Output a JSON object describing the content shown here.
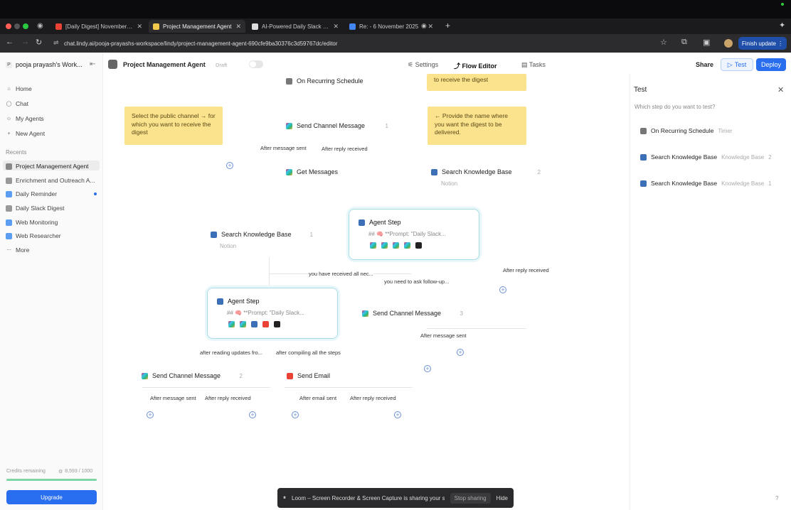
{
  "browser": {
    "tabs": [
      {
        "label": "[Daily Digest] November 6, 2",
        "icon": "gmail-icon"
      },
      {
        "label": "Project Management Agent",
        "icon": "lindy-icon",
        "active": true
      },
      {
        "label": "AI-Powered Daily Slack Digest",
        "icon": "notion-icon"
      },
      {
        "label": "Re: - 6 November 2025",
        "icon": "docs-icon"
      }
    ],
    "url": "chat.lindy.ai/pooja-prayashs-workspace/lindy/project-management-agent-690cfe9ba30376c3d59767dc/editor",
    "finish_update": "Finish update"
  },
  "sidebar": {
    "workspace": "pooja prayash's Work...",
    "workspace_initial": "P",
    "nav": [
      {
        "label": "Home",
        "icon": "home-icon"
      },
      {
        "label": "Chat",
        "icon": "chat-icon"
      },
      {
        "label": "My Agents",
        "icon": "agents-icon"
      },
      {
        "label": "New Agent",
        "icon": "plus-icon"
      }
    ],
    "recents_title": "Recents",
    "recents": [
      {
        "label": "Project Management Agent"
      },
      {
        "label": "Enrichment and Outreach A..."
      },
      {
        "label": "Daily Reminder"
      },
      {
        "label": "Daily Slack Digest"
      },
      {
        "label": "Web Monitoring"
      },
      {
        "label": "Web Researcher"
      }
    ],
    "more": "More",
    "credits_label": "Credits remaining",
    "credits_value": "8,593 / 1000",
    "upgrade": "Upgrade"
  },
  "header": {
    "agent_name": "Project Management Agent",
    "status": "Draft",
    "settings": "Settings",
    "flow_editor": "Flow Editor",
    "tasks": "Tasks",
    "share": "Share",
    "test": "Test",
    "deploy": "Deploy"
  },
  "canvas": {
    "notes": {
      "top_right": "to receive the digest",
      "left": "Select the public channel → for which you want to receive the digest",
      "right": "← Provide the name where you want the digest to be delivered."
    },
    "nodes": {
      "recurring": "On Recurring Schedule",
      "send_channel_1": "Send Channel Message",
      "get_messages": "Get Messages",
      "skb_right": "Search Knowledge Base",
      "skb_right_sub": "Notion",
      "skb_left": "Search Knowledge Base",
      "skb_left_sub": "Notion",
      "agent_1": "Agent Step",
      "agent_1_prompt": "## 🧠 **Prompt: \"Daily Slack...",
      "agent_2": "Agent Step",
      "agent_2_prompt": "## 🧠 **Prompt: \"Daily Slack...",
      "send_channel_2": "Send Channel Message",
      "send_channel_3": "Send Channel Message",
      "send_email": "Send Email",
      "badge_1": "1",
      "badge_2": "2",
      "badge_3": "1",
      "badge_4": "3",
      "badge_5": "2"
    },
    "edges": {
      "after_message_sent_1": "After message sent",
      "after_reply_received_1": "After reply received",
      "received_all": "you have received all nec...",
      "ask_followup": "you need to ask follow-up...",
      "after_reply_received_2": "After reply received",
      "after_message_sent_2": "After message sent",
      "after_reading": "after reading updates fro...",
      "after_compiling": "after compiling all the steps",
      "after_message_sent_3": "After message sent",
      "after_reply_received_3": "After reply received",
      "after_email_sent": "After email sent",
      "after_reply_received_4": "After reply received"
    }
  },
  "test_panel": {
    "title": "Test",
    "question": "Which step do you want to test?",
    "steps": [
      {
        "label": "On Recurring Schedule",
        "type": "Timer"
      },
      {
        "label": "Search Knowledge Base",
        "type": "Knowledge Base",
        "num": "2"
      },
      {
        "label": "Search Knowledge Base",
        "type": "Knowledge Base",
        "num": "1"
      }
    ]
  },
  "loom": {
    "text": "Loom – Screen Recorder & Screen Capture is sharing your screen.",
    "stop": "Stop sharing",
    "hide": "Hide"
  },
  "help": "?",
  "colors": {
    "accent": "#2a6ef0",
    "note": "#fbe28d",
    "agent_border": "#a8dde6"
  }
}
